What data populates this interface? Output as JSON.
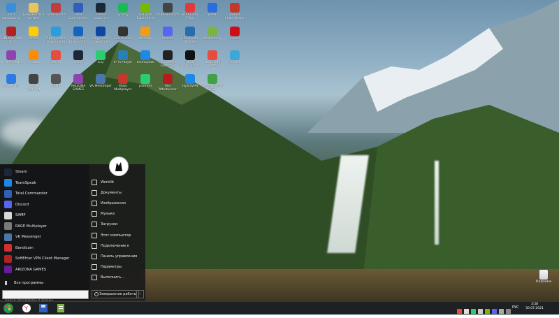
{
  "desktop": {
    "icons": [
      {
        "label": "Этот компьютер",
        "color": "#3a8fd8"
      },
      {
        "label": "Документы в ярлыке",
        "color": "#e8c45a"
      },
      {
        "label": "GameGuard",
        "color": "#c33b3b"
      },
      {
        "label": "Total Commander",
        "color": "#2f5fb8"
      },
      {
        "label": "Steam Launcher",
        "color": "#1b2838"
      },
      {
        "label": "Spotify",
        "color": "#1db954"
      },
      {
        "label": "GeForce Experience",
        "color": "#76b900"
      },
      {
        "label": "apkdownloader",
        "color": "#444"
      },
      {
        "label": "SHAREit PC Files",
        "color": "#e23a3a"
      },
      {
        "label": "WeMP",
        "color": "#2a6edb"
      },
      {
        "label": "Radmin ImaryViewer",
        "color": "#c0392b"
      },
      {
        "label": "SoftEther VPN Client",
        "color": "#b22222"
      },
      {
        "label": "Yandex",
        "color": "#ffcc00"
      },
      {
        "label": "Apply Video Downloader",
        "color": "#2d9cdb"
      },
      {
        "label": "Any Video Downloader",
        "color": "#1565c0"
      },
      {
        "label": "Any Video Downloader",
        "color": "#0d47a1"
      },
      {
        "label": "RussiaRadio",
        "color": "#333"
      },
      {
        "label": "Winamp",
        "color": "#f39c12"
      },
      {
        "label": "Discord",
        "color": "#5865f2"
      },
      {
        "label": "Download Master",
        "color": "#2b6cb0"
      },
      {
        "label": "WinMemory",
        "color": "#7cb342"
      },
      {
        "label": "Opera",
        "color": "#cc0f16"
      },
      {
        "label": "VK Messenger",
        "color": "#8e44ad"
      },
      {
        "label": "FL Studio",
        "color": "#ff8c00"
      },
      {
        "label": "GetIcon",
        "color": "#e74c3c"
      },
      {
        "label": "Steam",
        "color": "#1b2838"
      },
      {
        "label": "ICQ",
        "color": "#2ecc71"
      },
      {
        "label": "IP-TV Player",
        "color": "#2980b9"
      },
      {
        "label": "TeamSpeak",
        "color": "#1e88e5"
      },
      {
        "label": "Epic Games Launcher",
        "color": "#222"
      },
      {
        "label": "TikTok Downloader",
        "color": "#111"
      },
      {
        "label": "Download Master",
        "color": "#e74c3c"
      },
      {
        "label": "Proxifier",
        "color": "#3fa7d6"
      },
      {
        "label": "ArgentVPN",
        "color": "#2c7be5"
      },
      {
        "label": "SAMP Redirect",
        "color": "#444"
      },
      {
        "label": "SAMP",
        "color": "#555"
      },
      {
        "label": "ARIZONA GAMES",
        "color": "#8e44ad"
      },
      {
        "label": "VK Messenger",
        "color": "#4a76a8"
      },
      {
        "label": "RAGE Multiplayer",
        "color": "#c0392b"
      },
      {
        "label": "µTorrent",
        "color": "#2ecc71"
      },
      {
        "label": "MSI Afterburner",
        "color": "#b71c1c"
      },
      {
        "label": "HydraVPN",
        "color": "#1e88e5"
      },
      {
        "label": "Kerish Doctor 2021",
        "color": "#43a047"
      }
    ],
    "recycle_bin": {
      "label": "Корзина"
    }
  },
  "start_menu": {
    "left_items": [
      {
        "label": "Steam",
        "color": "#1b2838"
      },
      {
        "label": "TeamSpeak",
        "color": "#1e88e5"
      },
      {
        "label": "Total Commander",
        "color": "#2f5fb8"
      },
      {
        "label": "Discord",
        "color": "#5865f2"
      },
      {
        "label": "SAMP",
        "color": "#d9d9d9"
      },
      {
        "label": "RAGE Multiplayer",
        "color": "#7a7a7a"
      },
      {
        "label": "VK Messenger",
        "color": "#4a76a8"
      },
      {
        "label": "Bandicam",
        "color": "#d32f2f"
      },
      {
        "label": "SoftEther VPN Client Manager",
        "color": "#b22222"
      },
      {
        "label": "ARIZONA GAMES",
        "color": "#6a1b9a"
      }
    ],
    "all_programs": "Все программы",
    "search_placeholder": "Найти программы и файлы",
    "right_items": [
      "Worldlit",
      "Документы",
      "Изображения",
      "Музыка",
      "Загрузки",
      "Этот компьютер",
      "Подключение к",
      "Панель управления",
      "Параметры",
      "Выполнить..."
    ],
    "shutdown_label": "Завершение работы",
    "shutdown_arrow": "›"
  },
  "taskbar": {
    "lang": "РУС",
    "time": "3:58",
    "date": "30.07.2021"
  }
}
